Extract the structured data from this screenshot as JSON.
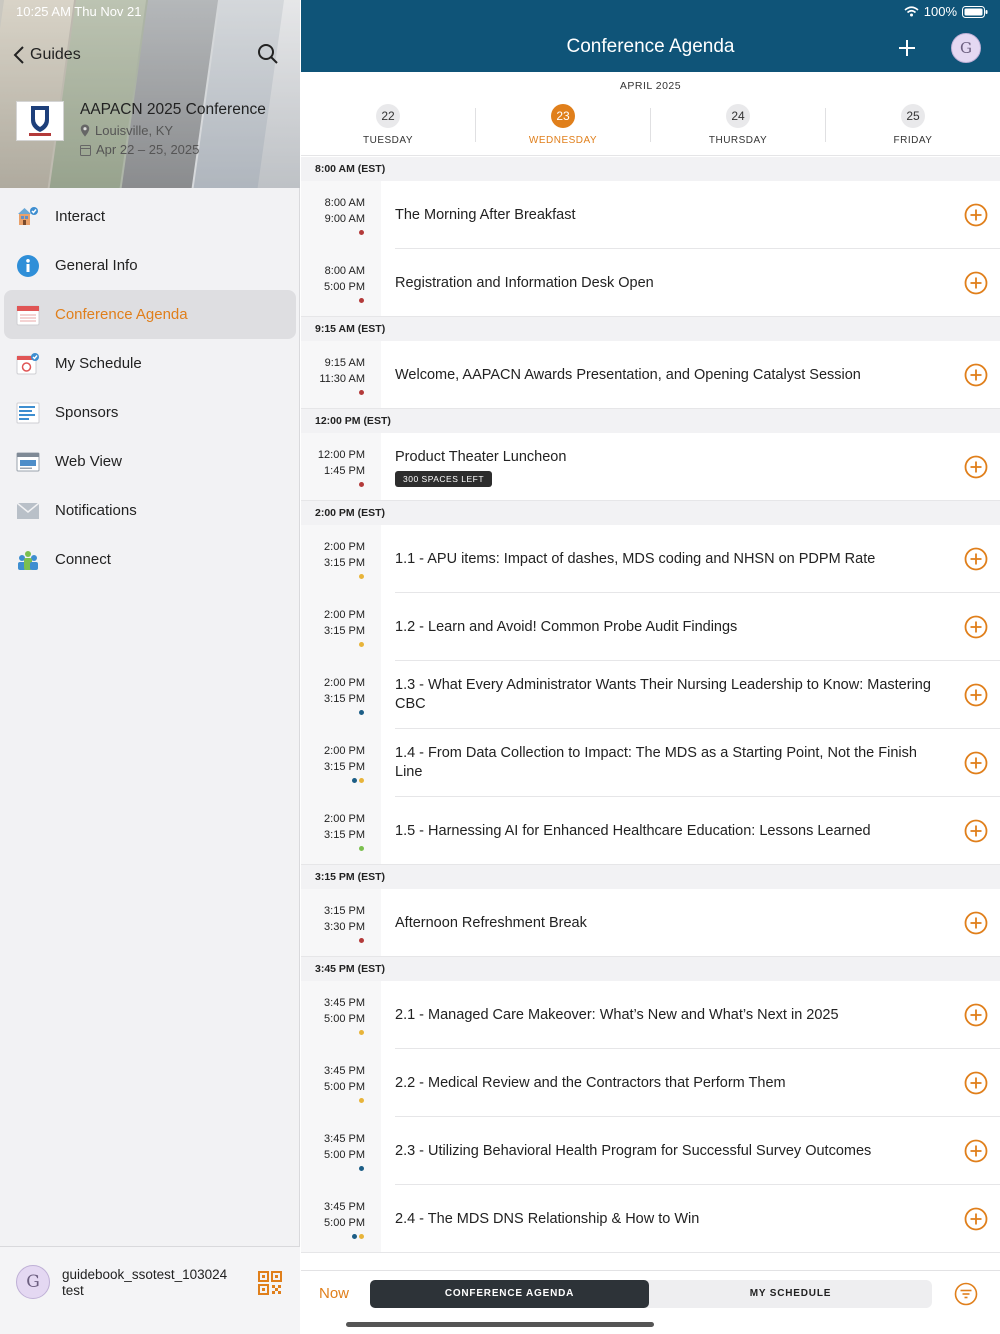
{
  "colors": {
    "header_bg": "#0f5478",
    "accent": "#e07f1b",
    "dot_red": "#b33a3a",
    "dot_yellow": "#e8b43a",
    "dot_blue": "#1d5e86",
    "dot_green": "#7bbf4f"
  },
  "status_bar": {
    "time": "10:25 AM   Thu Nov 21",
    "battery": "100%"
  },
  "sidebar": {
    "back_label": "Guides",
    "conference": {
      "title": "AAPACN 2025 Conference",
      "location": "Louisville, KY",
      "dates": "Apr 22 – 25, 2025"
    },
    "items": [
      {
        "label": "Interact",
        "icon": "interact-icon"
      },
      {
        "label": "General Info",
        "icon": "info-icon"
      },
      {
        "label": "Conference Agenda",
        "icon": "calendar-icon",
        "active": true
      },
      {
        "label": "My Schedule",
        "icon": "my-schedule-icon"
      },
      {
        "label": "Sponsors",
        "icon": "sponsors-icon"
      },
      {
        "label": "Web View",
        "icon": "web-view-icon"
      },
      {
        "label": "Notifications",
        "icon": "envelope-icon"
      },
      {
        "label": "Connect",
        "icon": "connect-icon"
      }
    ],
    "user": {
      "initial": "G",
      "name_line1": "guidebook_ssotest_103024",
      "name_line2": "test"
    }
  },
  "header": {
    "title": "Conference Agenda",
    "avatar_initial": "G"
  },
  "days": {
    "month": "APRIL 2025",
    "items": [
      {
        "num": "22",
        "name": "TUESDAY"
      },
      {
        "num": "23",
        "name": "WEDNESDAY",
        "selected": true
      },
      {
        "num": "24",
        "name": "THURSDAY"
      },
      {
        "num": "25",
        "name": "FRIDAY"
      }
    ]
  },
  "sections": [
    {
      "header": "8:00 AM (EST)",
      "sessions": [
        {
          "start": "8:00 AM",
          "end": "9:00 AM",
          "title": "The Morning After Breakfast",
          "dots": [
            "red"
          ]
        },
        {
          "start": "8:00 AM",
          "end": "5:00 PM",
          "title": "Registration and Information Desk Open",
          "dots": [
            "red"
          ]
        }
      ]
    },
    {
      "header": "9:15 AM (EST)",
      "sessions": [
        {
          "start": "9:15 AM",
          "end": "11:30 AM",
          "title": "Welcome, AAPACN Awards Presentation, and Opening Catalyst Session",
          "dots": [
            "red"
          ]
        }
      ]
    },
    {
      "header": "12:00 PM (EST)",
      "sessions": [
        {
          "start": "12:00 PM",
          "end": "1:45 PM",
          "title": "Product Theater Luncheon",
          "badge": "300 SPACES LEFT",
          "dots": [
            "red"
          ]
        }
      ]
    },
    {
      "header": "2:00 PM (EST)",
      "sessions": [
        {
          "start": "2:00 PM",
          "end": "3:15 PM",
          "title": "1.1 - APU items: Impact of dashes, MDS coding and NHSN on PDPM Rate",
          "dots": [
            "yellow"
          ]
        },
        {
          "start": "2:00 PM",
          "end": "3:15 PM",
          "title": "1.2 - Learn and Avoid! Common Probe Audit Findings",
          "dots": [
            "yellow"
          ]
        },
        {
          "start": "2:00 PM",
          "end": "3:15 PM",
          "title": "1.3 - What Every Administrator Wants Their Nursing Leadership to Know: Mastering CBC",
          "dots": [
            "blue"
          ]
        },
        {
          "start": "2:00 PM",
          "end": "3:15 PM",
          "title": "1.4 - From Data Collection to Impact: The MDS as a Starting Point, Not the Finish Line",
          "dots": [
            "blue",
            "yellow"
          ]
        },
        {
          "start": "2:00 PM",
          "end": "3:15 PM",
          "title": "1.5 - Harnessing AI for Enhanced Healthcare Education: Lessons Learned",
          "dots": [
            "green"
          ]
        }
      ]
    },
    {
      "header": "3:15 PM (EST)",
      "sessions": [
        {
          "start": "3:15 PM",
          "end": "3:30 PM",
          "title": "Afternoon Refreshment Break",
          "dots": [
            "red"
          ]
        }
      ]
    },
    {
      "header": "3:45 PM (EST)",
      "sessions": [
        {
          "start": "3:45 PM",
          "end": "5:00 PM",
          "title": "2.1 - Managed Care Makeover: What’s New and What’s Next in 2025",
          "dots": [
            "yellow"
          ]
        },
        {
          "start": "3:45 PM",
          "end": "5:00 PM",
          "title": "2.2 - Medical Review and the Contractors that Perform Them",
          "dots": [
            "yellow"
          ]
        },
        {
          "start": "3:45 PM",
          "end": "5:00 PM",
          "title": "2.3 - Utilizing Behavioral Health Program for Successful Survey Outcomes",
          "dots": [
            "blue"
          ]
        },
        {
          "start": "3:45 PM",
          "end": "5:00 PM",
          "title": "2.4 - The MDS DNS Relationship & How to Win",
          "dots": [
            "blue",
            "yellow"
          ]
        }
      ]
    }
  ],
  "bottom_bar": {
    "now_label": "Now",
    "tabs": [
      {
        "label": "CONFERENCE AGENDA",
        "active": true
      },
      {
        "label": "MY SCHEDULE"
      }
    ]
  }
}
